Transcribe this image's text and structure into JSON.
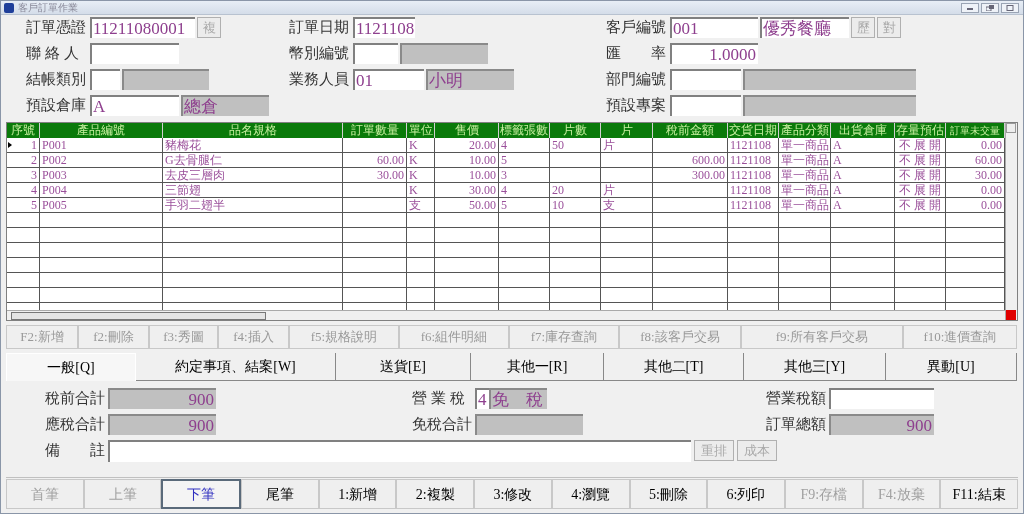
{
  "window": {
    "title": "客戶訂單作業"
  },
  "header": {
    "rows": [
      {
        "left": {
          "kind": "text",
          "label": "訂單憑證",
          "value": "11211080001",
          "buttons": [
            {
              "label": "複",
              "disabled": true
            }
          ]
        },
        "middle": {
          "kind": "text",
          "label": "訂單日期",
          "value": "1121108"
        },
        "right": {
          "kind": "named",
          "label": "客戶編號",
          "value": "001",
          "name": "優秀餐廳",
          "buttons": [
            {
              "label": "歷",
              "disabled": true
            },
            {
              "label": "對",
              "disabled": true
            }
          ]
        }
      },
      {
        "left": {
          "kind": "text",
          "label": "聯 絡 人"
        },
        "middle": {
          "kind": "lookup",
          "label": "幣別編號"
        },
        "right": {
          "kind": "number",
          "label": "匯　　率",
          "value": "1.0000"
        }
      },
      {
        "left": {
          "kind": "lookup",
          "label": "結帳類別"
        },
        "middle": {
          "kind": "lookup",
          "label": "業務人員",
          "value": "01",
          "name": "小明"
        },
        "right": {
          "kind": "lookup",
          "label": "部門編號"
        }
      },
      {
        "left": {
          "kind": "lookup",
          "label": "預設倉庫",
          "value": "A",
          "name": "總倉"
        },
        "right": {
          "kind": "lookup",
          "label": "預設專案"
        }
      }
    ]
  },
  "grid": {
    "columns": [
      "序號",
      "產品編號",
      "品名規格",
      "訂單數量",
      "單位",
      "售價",
      "標籤張數",
      "片數",
      "片",
      "稅前金額",
      "交貨日期",
      "產品分類",
      "出貨倉庫",
      "存量預估",
      "訂單未交量"
    ],
    "rows": [
      {
        "current": true,
        "cells": [
          "1",
          "P001",
          "豬梅花",
          null,
          "K",
          "20.00",
          "4",
          "50",
          "片",
          null,
          "1121108",
          "單一商品",
          "A",
          "不 展 開",
          "0.00"
        ]
      },
      {
        "current": false,
        "cells": [
          "2",
          "P002",
          "G去骨腿仁",
          "60.00",
          "K",
          "10.00",
          "5",
          null,
          null,
          "600.00",
          "1121108",
          "單一商品",
          "A",
          "不 展 開",
          "60.00"
        ]
      },
      {
        "current": false,
        "cells": [
          "3",
          "P003",
          "去皮三層肉",
          "30.00",
          "K",
          "10.00",
          "3",
          null,
          null,
          "300.00",
          "1121108",
          "單一商品",
          "A",
          "不 展 開",
          "30.00"
        ]
      },
      {
        "current": false,
        "cells": [
          "4",
          "P004",
          "三節翅",
          null,
          "K",
          "30.00",
          "4",
          "20",
          "片",
          null,
          "1121108",
          "單一商品",
          "A",
          "不 展 開",
          "0.00"
        ]
      },
      {
        "current": false,
        "cells": [
          "5",
          "P005",
          "手羽二翅半",
          null,
          "支",
          "50.00",
          "5",
          "10",
          "支",
          null,
          "1121108",
          "單一商品",
          "A",
          "不 展 開",
          "0.00"
        ]
      }
    ]
  },
  "function_keys": [
    {
      "label": "F2:新增",
      "disabled": true
    },
    {
      "label": "f2:刪除",
      "disabled": true
    },
    {
      "label": "f3:秀圖",
      "disabled": true
    },
    {
      "label": "f4:插入",
      "disabled": true
    },
    {
      "label": "f5:規格說明",
      "disabled": true
    },
    {
      "label": "f6:組件明細",
      "disabled": true
    },
    {
      "label": "f7:庫存查詢",
      "disabled": true
    },
    {
      "label": "f8:該客戶交易",
      "disabled": true
    },
    {
      "label": "f9:所有客戶交易",
      "disabled": true
    },
    {
      "label": "f10:進價查詢",
      "disabled": true
    }
  ],
  "tabs": [
    {
      "label": "一般[Q]",
      "selected": true
    },
    {
      "label": "約定事項、結案[W]",
      "selected": false
    },
    {
      "label": "送貨[E]",
      "selected": false
    },
    {
      "label": "其他一[R]",
      "selected": false
    },
    {
      "label": "其他二[T]",
      "selected": false
    },
    {
      "label": "其他三[Y]",
      "selected": false
    },
    {
      "label": "異動[U]",
      "selected": false
    }
  ],
  "totals": {
    "rows": [
      [
        {
          "kind": "gray",
          "label": "稅前合計",
          "value": "900"
        },
        {
          "kind": "code_name",
          "label": "營 業 稅",
          "value": "4",
          "name": "免　稅"
        },
        {
          "kind": "white",
          "label": "營業稅額"
        }
      ],
      [
        {
          "kind": "gray",
          "label": "應稅合計",
          "value": "900"
        },
        {
          "kind": "gray",
          "label": "免稅合計"
        },
        {
          "kind": "gray",
          "label": "訂單總額",
          "value": "900"
        }
      ]
    ],
    "remarks": {
      "label": "備　　註",
      "buttons": [
        {
          "label": "重排",
          "disabled": true
        },
        {
          "label": "成本",
          "disabled": true
        }
      ]
    }
  },
  "nav_buttons": [
    {
      "label": "首筆",
      "disabled": true,
      "focused": false
    },
    {
      "label": "上筆",
      "disabled": true,
      "focused": false
    },
    {
      "label": "下筆",
      "disabled": false,
      "focused": true
    },
    {
      "label": "尾筆",
      "disabled": false,
      "focused": false
    },
    {
      "label": "1:新增",
      "disabled": false,
      "focused": false
    },
    {
      "label": "2:複製",
      "disabled": false,
      "focused": false
    },
    {
      "label": "3:修改",
      "disabled": false,
      "focused": false
    },
    {
      "label": "4:瀏覽",
      "disabled": false,
      "focused": false
    },
    {
      "label": "5:刪除",
      "disabled": false,
      "focused": false
    },
    {
      "label": "6:列印",
      "disabled": false,
      "focused": false
    },
    {
      "label": "F9:存檔",
      "disabled": true,
      "focused": false
    },
    {
      "label": "F4:放棄",
      "disabled": true,
      "focused": false
    },
    {
      "label": "F11:結束",
      "disabled": false,
      "focused": false
    }
  ]
}
